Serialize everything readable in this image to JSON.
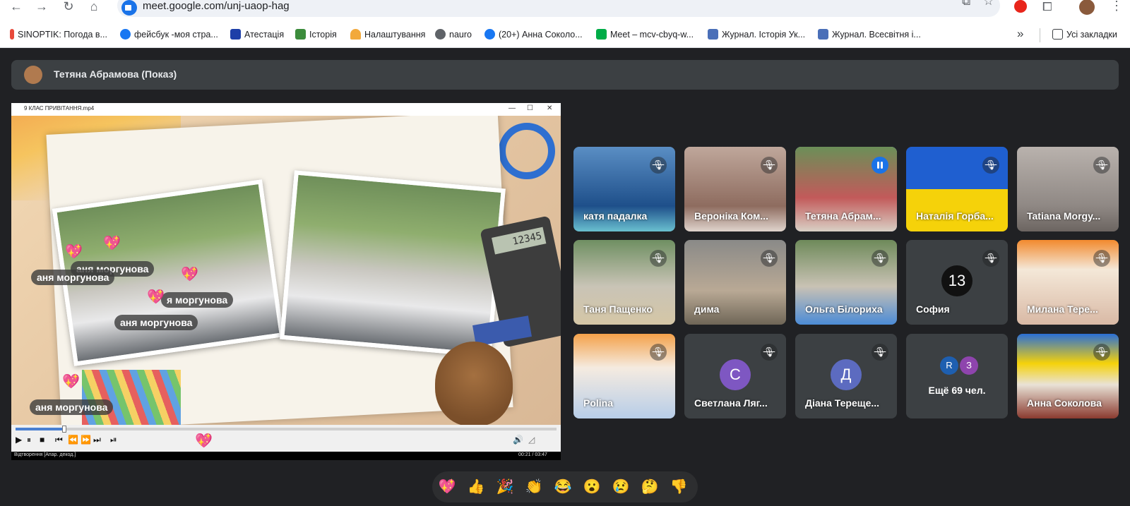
{
  "browser": {
    "url": "meet.google.com/unj-uaop-hag",
    "bookmarks": [
      {
        "label": "SINOPTIK: Погода в...",
        "icon_color": "#e84a3b"
      },
      {
        "label": "фейсбук -моя стра...",
        "icon_color": "#1877f2"
      },
      {
        "label": "Атестація",
        "icon_color": "#1d3fa8"
      },
      {
        "label": "Історія",
        "icon_color": "#3c8c3c"
      },
      {
        "label": "Налаштування",
        "icon_color": "#f2a93b"
      },
      {
        "label": "nauro",
        "icon_color": "#5f6368"
      },
      {
        "label": "(20+) Анна Соколо...",
        "icon_color": "#1877f2"
      },
      {
        "label": "Meet – mcv-cbyq-w...",
        "icon_color": "#00ac47"
      },
      {
        "label": "Журнал. Історія Ук...",
        "icon_color": "#4a6fb8"
      },
      {
        "label": "Журнал. Всесвітня і...",
        "icon_color": "#4a6fb8"
      }
    ],
    "all_bookmarks_label": "Усі закладки"
  },
  "presenter": {
    "label": "Тетяна Абрамова (Показ)"
  },
  "player": {
    "title": "9 КЛАС ПРИВІТАННЯ.mp4",
    "status": "Відтворення [Апар. декод.]",
    "time": "00:21 / 03:47",
    "progress": 0.09,
    "name_tags": [
      "аня моргунова",
      "аня моргунова",
      "я моргунова",
      "аня моргунова",
      "аня моргунова"
    ]
  },
  "participants": [
    {
      "name": "катя падалка",
      "muted": true,
      "bg": "linear-gradient(180deg,#5a8ec4,#1e4f8a 70%,#6ac0d0)"
    },
    {
      "name": "Вероніка Ком...",
      "muted": true,
      "bg": "linear-gradient(180deg,#bfa79b,#8e6c5f 70%,#e0d4cd)"
    },
    {
      "name": "Тетяна Абрам...",
      "muted": false,
      "bg": "linear-gradient(180deg,#6b8f58,#c25a5a 60%,#d9d0c5)",
      "active": true
    },
    {
      "name": "Наталія Горба...",
      "muted": true,
      "bg": "linear-gradient(180deg,#1f5fd0 0%,#1f5fd0 50%,#f5d20a 50%,#f5d20a 100%)"
    },
    {
      "name": "Tatiana Morgу...",
      "muted": true,
      "bg": "linear-gradient(180deg,#b9b2ad,#8f8884 70%,#6c6561)"
    },
    {
      "name": "Таня Пащенко",
      "muted": true,
      "bg": "linear-gradient(180deg,#6f8f62,#c9c4b6 55%,#d5c6a6)"
    },
    {
      "name": "дима",
      "muted": true,
      "bg": "linear-gradient(180deg,#8a8a88,#b9a995 60%,#6f6657)"
    },
    {
      "name": "Ольга Білориха",
      "muted": true,
      "bg": "linear-gradient(180deg,#6e8a5a,#c9c2b4 55%,#4c8cd6)"
    },
    {
      "name": "София",
      "muted": true,
      "initial": "13",
      "initial_bg": "#111111"
    },
    {
      "name": "Милана Тере...",
      "muted": true,
      "bg": "linear-gradient(180deg,#f28a2e,#f4e8d8 35%,#d9b9a5)"
    },
    {
      "name": "Polina",
      "muted": true,
      "bg": "linear-gradient(180deg,#f4a14a,#f5ebe0 40%,#b7cde8)"
    },
    {
      "name": "Светлана Ляг...",
      "muted": true,
      "initial": "С",
      "initial_bg": "#7e57c2"
    },
    {
      "name": "Діана Терещe...",
      "muted": true,
      "initial": "Д",
      "initial_bg": "#5c6bc0"
    },
    {
      "name": "Ещё 69 чел.",
      "more": true,
      "avatars": [
        {
          "letter": "R",
          "color": "#1e5fb0"
        },
        {
          "letter": "З",
          "color": "#8e44ad"
        }
      ]
    },
    {
      "name": "Анна Соколова",
      "muted": true,
      "bg": "linear-gradient(180deg,#2a6fd6 0%,#f5d20a 35%,#e9e2d6 60%,#8a3a2f)"
    }
  ],
  "reactions": [
    "💖",
    "👍",
    "🎉",
    "👏",
    "😂",
    "😮",
    "😢",
    "🤔",
    "👎"
  ]
}
